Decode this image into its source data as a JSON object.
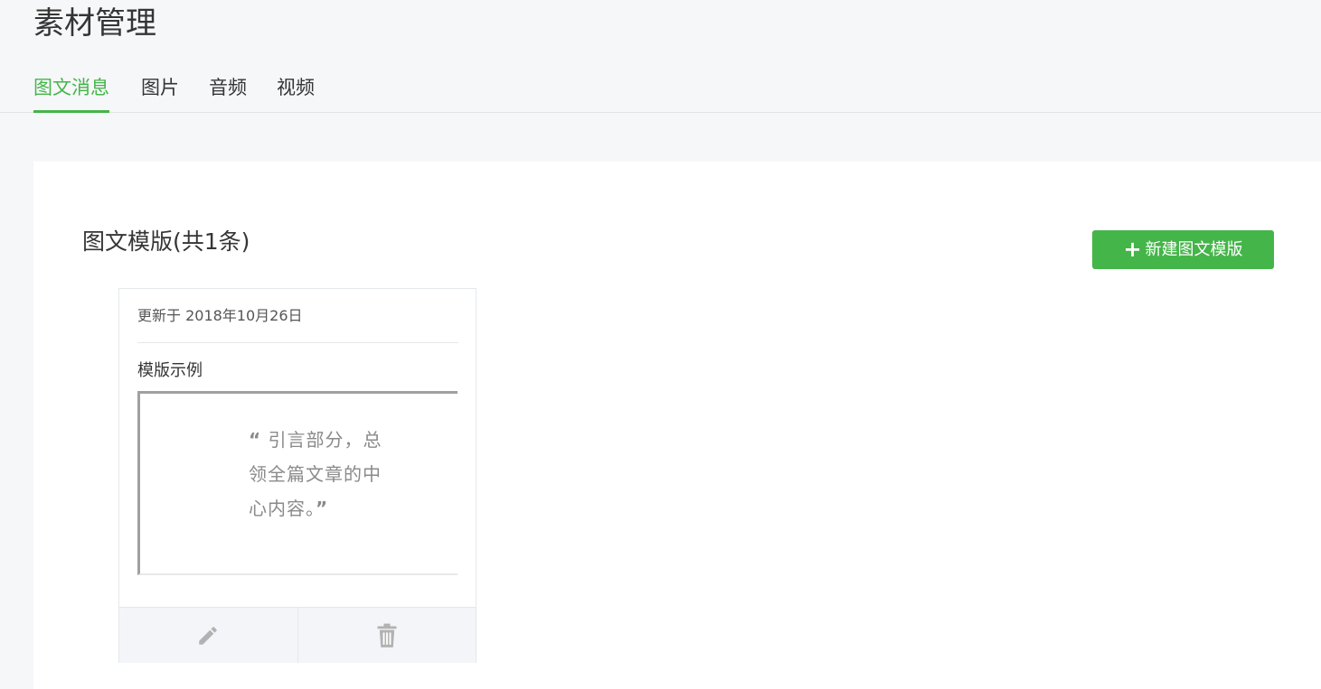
{
  "page": {
    "title": "素材管理"
  },
  "tabs": [
    {
      "label": "图文消息",
      "active": true
    },
    {
      "label": "图片",
      "active": false
    },
    {
      "label": "音频",
      "active": false
    },
    {
      "label": "视频",
      "active": false
    }
  ],
  "section": {
    "title": "图文模版(共1条)",
    "new_button_icon": "plus-icon",
    "new_button_label": "新建图文模版"
  },
  "template_card": {
    "updated": "更新于 2018年10月26日",
    "name": "模版示例",
    "preview": {
      "open_mark": "“",
      "text": " 引言部分，总领全篇文章的中心内容。",
      "close_mark": "”"
    },
    "actions": [
      {
        "icon": "pencil-icon",
        "label": "edit"
      },
      {
        "icon": "trash-icon",
        "label": "delete"
      }
    ]
  },
  "colors": {
    "accent": "#44b549",
    "background": "#f6f7f9",
    "text": "#353535",
    "icon": "#b2b2b2"
  }
}
